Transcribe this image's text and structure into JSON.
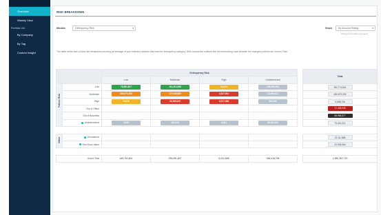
{
  "sidebar": {
    "section_1": "Dashboard",
    "items_1": [
      {
        "label": "Overview",
        "active": true
      },
      {
        "label": "Weekly View",
        "active": false
      }
    ],
    "section_2": "Portfolio List",
    "items_2": [
      {
        "label": "By Company"
      },
      {
        "label": "By Tag"
      },
      {
        "label": "Custom Insight"
      }
    ]
  },
  "panel": {
    "title": "RISK BREAKDOWN",
    "module_label": "Module",
    "module_value": "Delinquency Risk",
    "show_label": "Show",
    "show_value": "By Account Rating",
    "show_hint": "Change how data is grouped",
    "description": "The table below lists of total risk breakdown showing percentage of your selected portfolio that rises for delinquency category. With companies outlined like the intersecting rows beneath the changes portfolio are used in Risk."
  },
  "table": {
    "group_header": "Delinquency Risk",
    "total_header": "Total",
    "columns": [
      "Low",
      "Moderate",
      "High",
      "Undetermined"
    ],
    "section_a_label": "Failure Risk",
    "section_b_label": "Other",
    "rows_a": [
      {
        "label": "Low",
        "cells": [
          "76,861,827",
          "111,413,288",
          "12,431",
          "105,680,280"
        ],
        "total": "902,774,840"
      },
      {
        "label": "Moderate",
        "cells": [
          "360,871,693",
          "175,638,650",
          "3,847,081",
          "12,483,421"
        ],
        "total": "639,572,009"
      },
      {
        "label": "High",
        "cells": [
          "76,816",
          "26,396,830",
          "6,017,088",
          "503,702"
        ],
        "total": "6,838,706"
      },
      {
        "label": "Out of Office",
        "cells": [
          "",
          "",
          "",
          ""
        ],
        "total": "17,436,935"
      },
      {
        "label": "Out of Business",
        "cells": [
          "",
          "",
          "",
          ""
        ],
        "total": "85,965,877"
      },
      {
        "label": "Undetermined",
        "cells": [
          "4,876",
          "100,316",
          "2,361",
          "55,142,204"
        ],
        "total": "79,491,321"
      }
    ],
    "rows_b": [
      {
        "label": "Unmatched",
        "total": "22,111,858"
      },
      {
        "label": "Non-Scan Value",
        "total": "20,918,954"
      }
    ],
    "grand_total_label": "Grand Total",
    "grand_totals": [
      "449,763,801",
      "235,091,607",
      "6,241,808",
      "186,418,706"
    ],
    "grand_total_sum": "1,390,357,719"
  },
  "colors": {
    "green": "#2ea44f",
    "orange": "#f28a1e",
    "yellow": "#f0b429",
    "red": "#d93c2b",
    "grey": "#b7c2cf",
    "accent": "#12b3c8",
    "sidebar": "#0e2a47"
  },
  "pill_colors": [
    [
      "green",
      "green",
      "yellow",
      "grey"
    ],
    [
      "orange",
      "orange",
      "red",
      "grey"
    ],
    [
      "yellow",
      "red",
      "red",
      "grey"
    ],
    [
      "",
      "",
      "",
      ""
    ],
    [
      "",
      "",
      "",
      ""
    ],
    [
      "grey",
      "grey",
      "grey",
      "grey"
    ]
  ]
}
